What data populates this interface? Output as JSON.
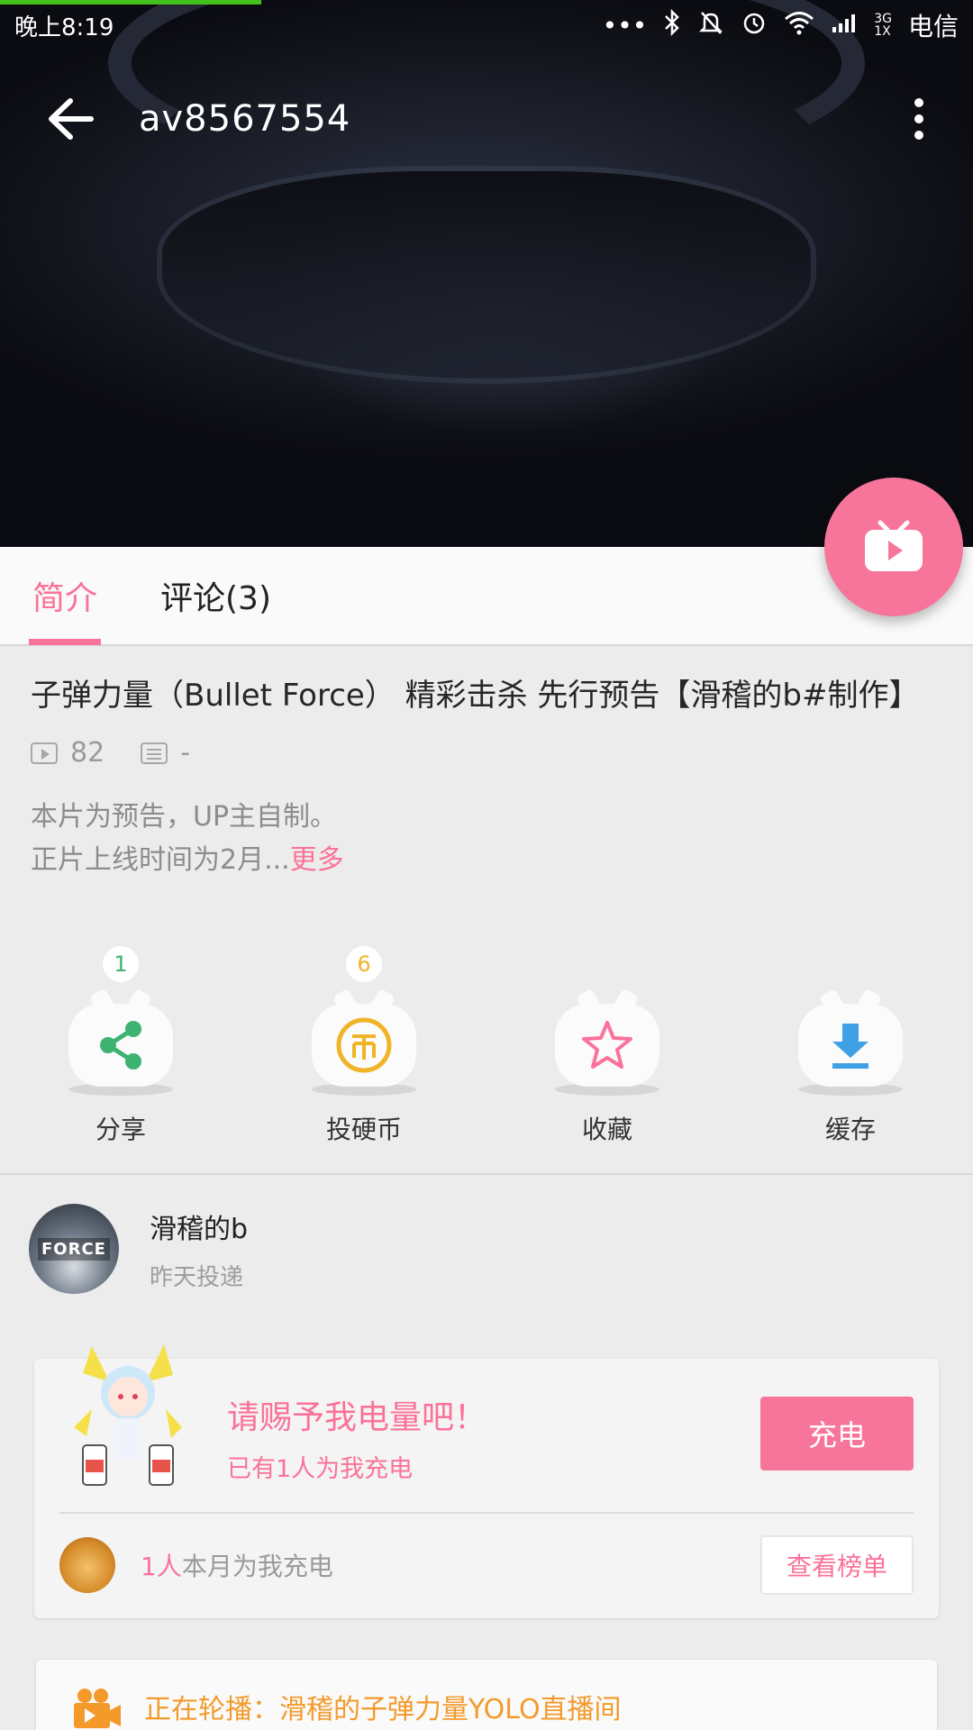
{
  "status_bar": {
    "time": "晚上8:19",
    "icons": [
      "more-dots-icon",
      "bluetooth-icon",
      "mute-bell-icon",
      "alarm-icon",
      "wifi-icon",
      "signal-icon"
    ],
    "network_type": "3G\n1X",
    "carrier": "电信"
  },
  "header": {
    "title": "av8567554"
  },
  "tabs": [
    {
      "label": "简介",
      "active": true
    },
    {
      "label": "评论(3)",
      "active": false
    }
  ],
  "video": {
    "title": "子弹力量（Bullet Force） 精彩击杀 先行预告【滑稽的b#制作】",
    "play_count": "82",
    "danmaku_count": "-",
    "description_line1": "本片为预告，UP主自制。",
    "description_line2": "正片上线时间为2月...",
    "more_label": "更多"
  },
  "actions": [
    {
      "label": "分享",
      "count": "1",
      "icon": "share-icon",
      "color": "#3cb371"
    },
    {
      "label": "投硬币",
      "count": "6",
      "icon": "coin-icon",
      "color": "#f0b429"
    },
    {
      "label": "收藏",
      "count": "",
      "icon": "star-icon",
      "color": "#fb7299"
    },
    {
      "label": "缓存",
      "count": "",
      "icon": "download-icon",
      "color": "#3fa0e6"
    }
  ],
  "uploader": {
    "name": "滑稽的b",
    "time": "昨天投递",
    "avatar_text": "FORCE"
  },
  "charge": {
    "title": "请赐予我电量吧！",
    "subtitle": "已有1人为我充电",
    "button_label": "充电",
    "count": "1人",
    "count_suffix": "本月为我充电",
    "rank_button_label": "查看榜单"
  },
  "live": {
    "text": "正在轮播：滑稽的子弹力量YOLO直播间"
  },
  "colors": {
    "accent": "#fb7299",
    "live_orange": "#f39a2b",
    "progress_green": "#43c21e"
  }
}
